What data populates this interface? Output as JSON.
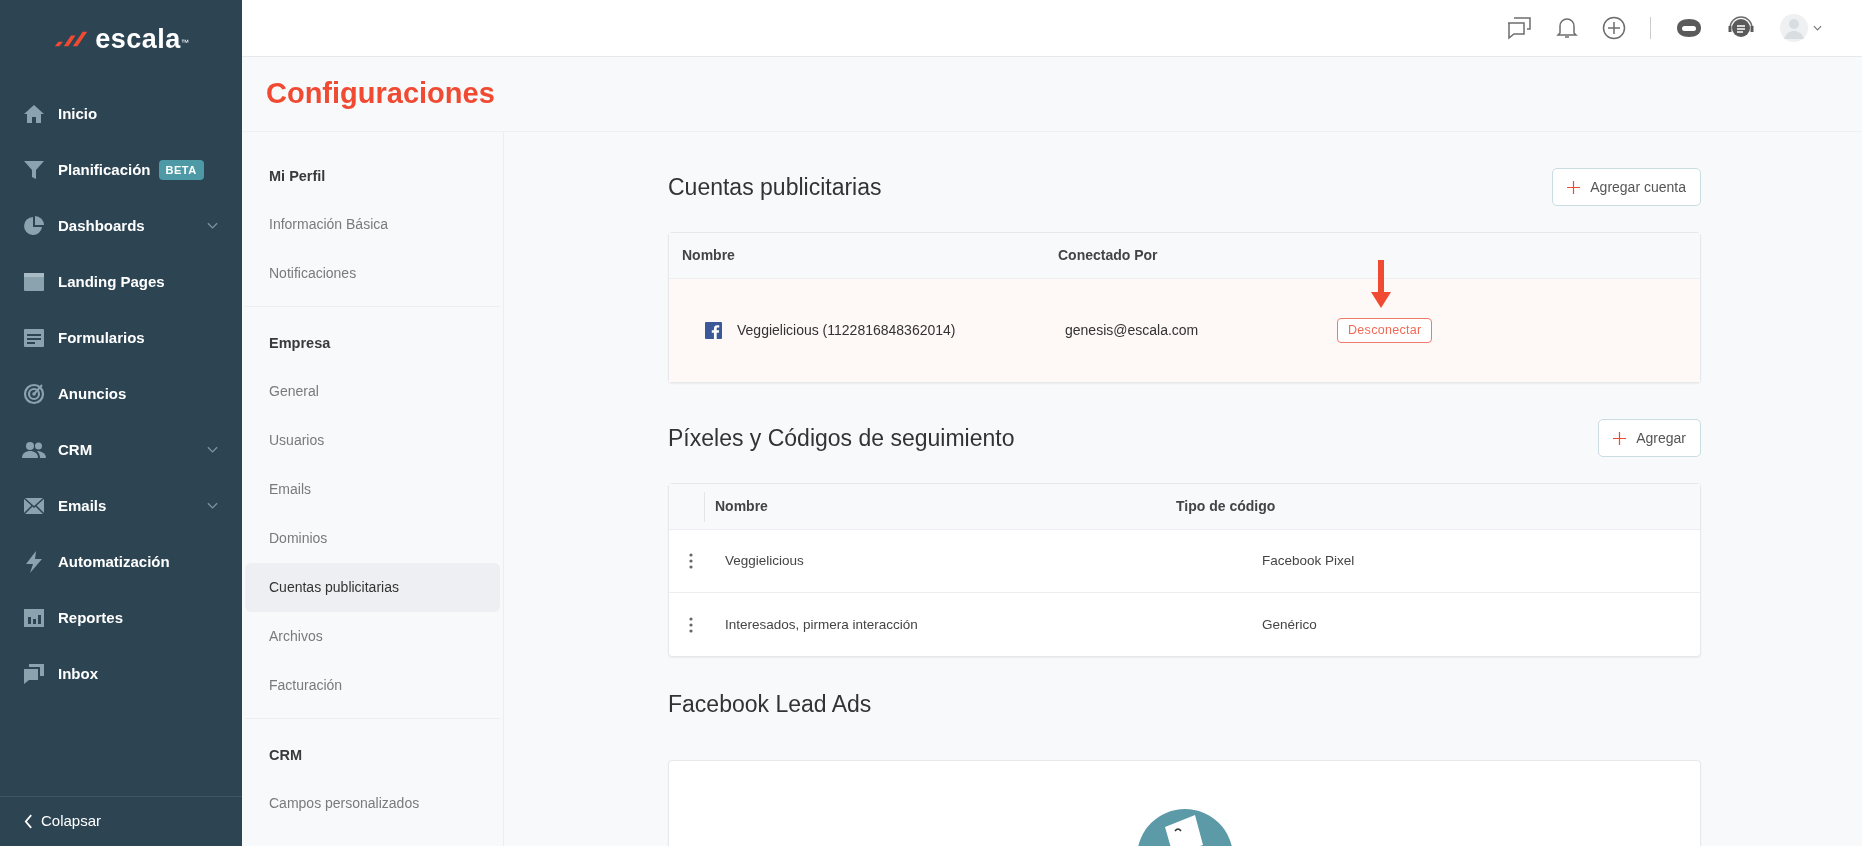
{
  "brand": {
    "name": "escala",
    "mark": "™"
  },
  "sidebar": {
    "items": [
      {
        "label": "Inicio",
        "has_submenu": false
      },
      {
        "label": "Planificación",
        "has_submenu": false,
        "badge": "BETA"
      },
      {
        "label": "Dashboards",
        "has_submenu": true
      },
      {
        "label": "Landing Pages",
        "has_submenu": false
      },
      {
        "label": "Formularios",
        "has_submenu": false
      },
      {
        "label": "Anuncios",
        "has_submenu": false
      },
      {
        "label": "CRM",
        "has_submenu": true
      },
      {
        "label": "Emails",
        "has_submenu": true
      },
      {
        "label": "Automatización",
        "has_submenu": false
      },
      {
        "label": "Reportes",
        "has_submenu": false
      },
      {
        "label": "Inbox",
        "has_submenu": false
      }
    ],
    "collapse": "Colapsar"
  },
  "page_title": "Configuraciones",
  "settings_nav": {
    "sections": [
      {
        "title": "Mi Perfil",
        "items": [
          {
            "label": "Información Básica",
            "selected": false
          },
          {
            "label": "Notificaciones",
            "selected": false
          }
        ]
      },
      {
        "title": "Empresa",
        "items": [
          {
            "label": "General",
            "selected": false
          },
          {
            "label": "Usuarios",
            "selected": false
          },
          {
            "label": "Emails",
            "selected": false
          },
          {
            "label": "Dominios",
            "selected": false
          },
          {
            "label": "Cuentas publicitarias",
            "selected": true
          },
          {
            "label": "Archivos",
            "selected": false
          },
          {
            "label": "Facturación",
            "selected": false
          }
        ]
      },
      {
        "title": "CRM",
        "items": [
          {
            "label": "Campos personalizados",
            "selected": false
          }
        ]
      }
    ]
  },
  "ad_accounts": {
    "title": "Cuentas publicitarias",
    "add_button": "Agregar cuenta",
    "columns": [
      "Nombre",
      "Conectado Por"
    ],
    "rows": [
      {
        "name": "Veggielicious (1122816848362014)",
        "connected_by": "genesis@escala.com",
        "action": "Desconectar",
        "highlighted": true
      }
    ]
  },
  "pixels": {
    "title": "Píxeles y Códigos de seguimiento",
    "add_button": "Agregar",
    "columns": [
      "Nombre",
      "Tipo de código"
    ],
    "rows": [
      {
        "name": "Veggielicious",
        "type": "Facebook Pixel"
      },
      {
        "name": "Interesados, pirmera interacción",
        "type": "Genérico"
      }
    ]
  },
  "lead_ads": {
    "title": "Facebook Lead Ads"
  }
}
